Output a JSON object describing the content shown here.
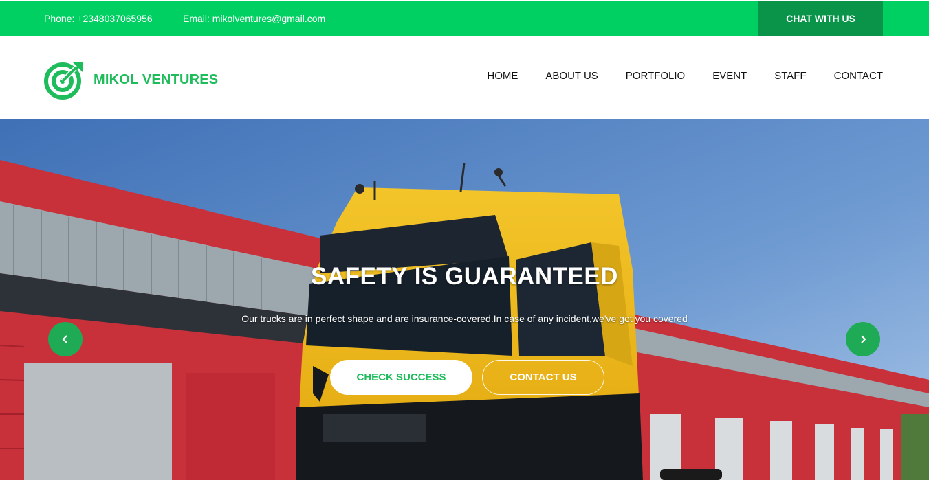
{
  "topbar": {
    "phone": "Phone: +2348037065956",
    "email": "Email: mikolventures@gmail.com",
    "chat_label": "CHAT WITH US"
  },
  "header": {
    "brand": "MIKOL VENTURES",
    "logo_icon": "target-arrow-icon",
    "nav": [
      "HOME",
      "ABOUT US",
      "PORTFOLIO",
      "EVENT",
      "STAFF",
      "CONTACT"
    ]
  },
  "hero": {
    "title": "SAFETY IS GUARANTEED",
    "subtitle": "Our trucks are in perfect shape and are insurance-covered.In case of any incident,we've got you covered",
    "primary_button": "CHECK SUCCESS",
    "secondary_button": "CONTACT US",
    "prev_icon": "chevron-left-icon",
    "next_icon": "chevron-right-icon"
  },
  "colors": {
    "brand_green": "#00d062",
    "dark_green": "#09944a",
    "logo_green": "#1fbc5c"
  }
}
